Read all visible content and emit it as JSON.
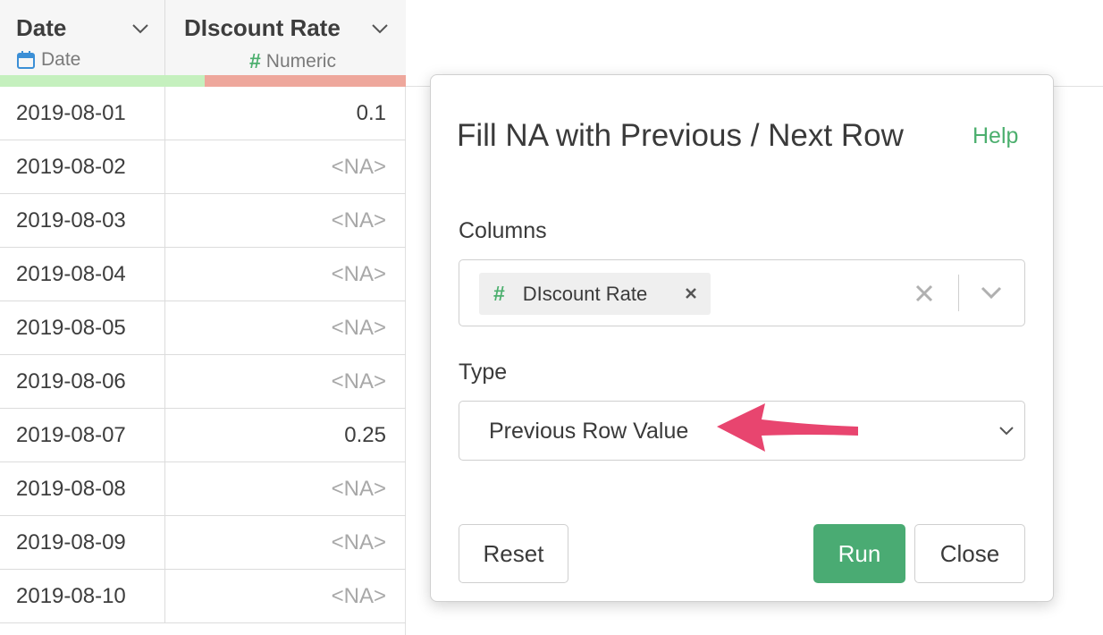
{
  "table": {
    "columns": [
      {
        "name": "Date",
        "type_label": "Date",
        "type_icon": "calendar-icon"
      },
      {
        "name": "DIscount Rate",
        "type_label": "Numeric",
        "type_icon": "hash-icon",
        "type_symbol": "#"
      }
    ],
    "rows": [
      {
        "date": "2019-08-01",
        "value": "0.1"
      },
      {
        "date": "2019-08-02",
        "value": "<NA>"
      },
      {
        "date": "2019-08-03",
        "value": "<NA>"
      },
      {
        "date": "2019-08-04",
        "value": "<NA>"
      },
      {
        "date": "2019-08-05",
        "value": "<NA>"
      },
      {
        "date": "2019-08-06",
        "value": "<NA>"
      },
      {
        "date": "2019-08-07",
        "value": "0.25"
      },
      {
        "date": "2019-08-08",
        "value": "<NA>"
      },
      {
        "date": "2019-08-09",
        "value": "<NA>"
      },
      {
        "date": "2019-08-10",
        "value": "<NA>"
      }
    ]
  },
  "dialog": {
    "title": "Fill NA with Previous / Next Row",
    "help_label": "Help",
    "columns_label": "Columns",
    "selected_column": {
      "symbol": "#",
      "name": "DIscount Rate"
    },
    "type_label": "Type",
    "type_value": "Previous Row Value",
    "reset_label": "Reset",
    "run_label": "Run",
    "close_label": "Close"
  },
  "colors": {
    "accent_green": "#4aab73",
    "quality_valid": "#c5f0be",
    "quality_missing": "#eea79c",
    "annotation_arrow": "#e8456f"
  }
}
